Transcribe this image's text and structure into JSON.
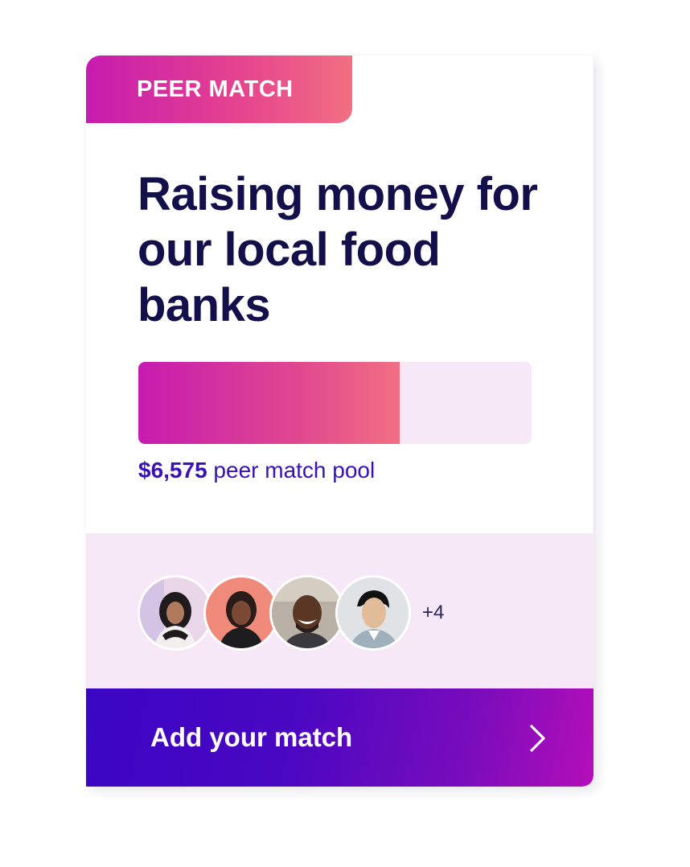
{
  "card": {
    "tag": "PEER MATCH",
    "headline": "Raising money for our local food banks",
    "progress": {
      "fraction": 0.665
    },
    "pool": {
      "amount": "$6,575",
      "label": " peer match pool"
    },
    "supporters": {
      "avatars": [
        "avatar-1",
        "avatar-2",
        "avatar-3",
        "avatar-4"
      ],
      "more_count": "+4"
    },
    "cta": {
      "label": "Add your match",
      "icon": "chevron-right-icon"
    }
  },
  "colors": {
    "headline": "#120f4a",
    "accent_purple": "#3a10b8",
    "gradient_pink_start": "#c61bb0",
    "gradient_pink_end": "#f26f82",
    "panel_tint": "#f6e8f6"
  }
}
